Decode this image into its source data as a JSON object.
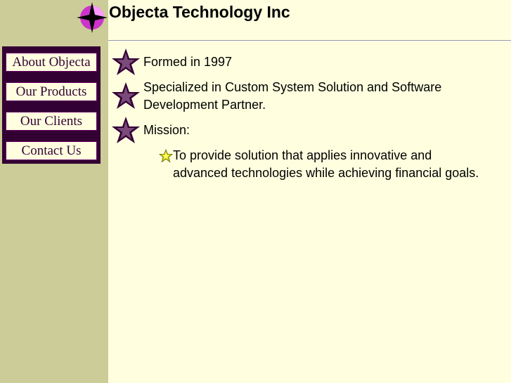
{
  "header": {
    "title": "Objecta Technology Inc",
    "logo_icon": "compass-star-icon"
  },
  "nav": {
    "items": [
      {
        "label": "About Objecta"
      },
      {
        "label": "Our Products"
      },
      {
        "label": "Our Clients"
      },
      {
        "label": "Contact Us"
      }
    ]
  },
  "content": {
    "bullet_icon": "purple-star-icon",
    "sub_bullet_icon": "yellow-star-icon",
    "items": [
      {
        "text": "Formed in 1997"
      },
      {
        "text": "Specialized in Custom System Solution and Software Development Partner."
      },
      {
        "text": "Mission:"
      }
    ],
    "sub_items": [
      {
        "text": "To provide solution that applies innovative and advanced technologies while achieving financial goals."
      }
    ]
  },
  "colors": {
    "page_background": "#ffffe0",
    "sidebar_background": "#cccc99",
    "nav_background": "#330033",
    "accent_magenta": "#cc33cc"
  }
}
